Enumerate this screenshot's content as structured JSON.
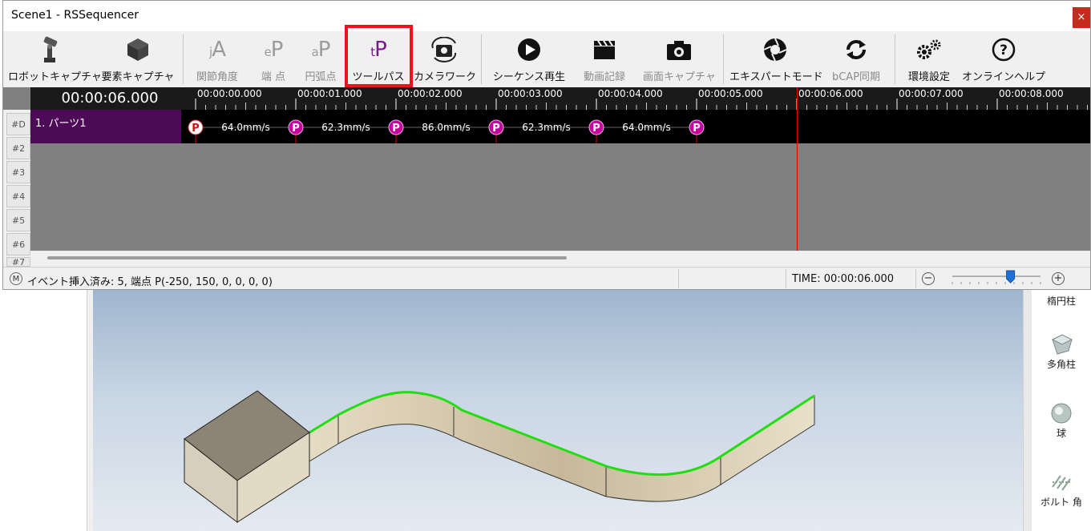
{
  "window": {
    "title": "Scene1 - RSSequencer",
    "close_glyph": "×"
  },
  "toolbar": [
    {
      "id": "robot-capture",
      "label": "ロボットキャプチャ",
      "icon": "robot-arm-icon",
      "enabled": true
    },
    {
      "id": "element-capture",
      "label": "要素キャプチャ",
      "icon": "cube-icon",
      "enabled": true
    },
    {
      "id": "joint-angle",
      "label": "関節角度",
      "icon_text": "jA",
      "icon": "joint-angle-icon",
      "enabled": false
    },
    {
      "id": "end-point",
      "label": "端 点",
      "icon_text": "eP",
      "icon": "end-point-icon",
      "enabled": false
    },
    {
      "id": "arc-point",
      "label": "円弧点",
      "icon_text": "aP",
      "icon": "arc-point-icon",
      "enabled": false
    },
    {
      "id": "tool-path",
      "label": "ツールパス",
      "icon_text": "tP",
      "icon": "tool-path-icon",
      "enabled": true,
      "highlighted": true
    },
    {
      "id": "camera-work",
      "label": "カメラワーク",
      "icon": "camera-rotate-icon",
      "enabled": true
    },
    {
      "id": "sequence-play",
      "label": "シーケンス再生",
      "icon": "play-icon",
      "enabled": true
    },
    {
      "id": "video-record",
      "label": "動画記録",
      "icon": "clapperboard-icon",
      "enabled": false
    },
    {
      "id": "screen-capture",
      "label": "画面キャプチャ",
      "icon": "camera-icon",
      "enabled": false
    },
    {
      "id": "expert-mode",
      "label": "エキスパートモード",
      "icon": "aperture-icon",
      "enabled": true
    },
    {
      "id": "bcap-sync",
      "label": "bCAP同期",
      "icon": "sync-icon",
      "enabled": false
    },
    {
      "id": "env-settings",
      "label": "環境設定",
      "icon": "gears-icon",
      "enabled": true
    },
    {
      "id": "online-help",
      "label": "オンラインヘルプ",
      "icon": "help-icon",
      "enabled": true
    }
  ],
  "timeline": {
    "current_time": "00:00:06.000",
    "current_seconds": 6.0,
    "ticks": [
      "00:00:00.000",
      "00:00:01.000",
      "00:00:02.000",
      "00:00:03.000",
      "00:00:04.000",
      "00:00:05.000",
      "00:00:06.000",
      "00:00:07.000",
      "00:00:08.000"
    ],
    "rows": [
      "#D",
      "#2",
      "#3",
      "#4",
      "#5",
      "#6",
      "#7"
    ],
    "track": {
      "name": "1. パーツ1",
      "points": [
        {
          "t": 0,
          "label": "P",
          "first": true
        },
        {
          "t": 1,
          "label": "P"
        },
        {
          "t": 2,
          "label": "P"
        },
        {
          "t": 3,
          "label": "P"
        },
        {
          "t": 4,
          "label": "P"
        },
        {
          "t": 5,
          "label": "P"
        }
      ],
      "speeds": [
        "64.0mm/s",
        "62.3mm/s",
        "86.0mm/s",
        "62.3mm/s",
        "64.0mm/s"
      ]
    }
  },
  "status": {
    "mode_glyph": "M",
    "message": "イベント挿入済み: 5, 端点 P(-250, 150, 0, 0, 0, 0)",
    "time": "TIME: 00:00:06.000",
    "zoom_minus": "−",
    "zoom_plus": "+",
    "zoom_level": 0.66
  },
  "right_panel": [
    {
      "label": "楕円柱",
      "icon": "elliptic-cylinder-icon"
    },
    {
      "label": "多角柱",
      "icon": "polygon-prism-icon"
    },
    {
      "label": "球",
      "icon": "sphere-icon"
    },
    {
      "label": "ボルト 角",
      "icon": "bolt-icon"
    }
  ],
  "colors": {
    "accent_highlight": "#e8141e",
    "track_name_bg": "#4d0a57",
    "point_magenta": "#c6009d",
    "playhead": "#e00000",
    "path_green": "#22dd11"
  }
}
